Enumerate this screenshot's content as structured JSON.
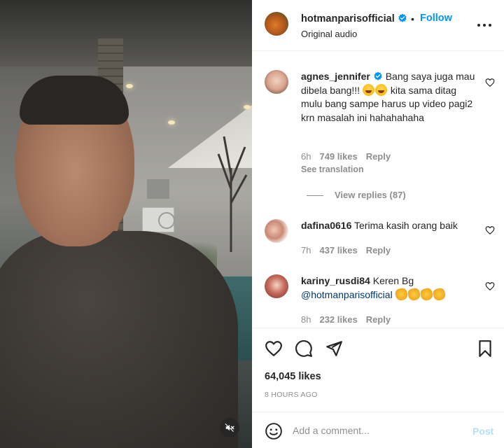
{
  "header": {
    "username": "hotmanparisofficial",
    "separator": "•",
    "follow_label": "Follow",
    "subtitle": "Original audio"
  },
  "comments": [
    {
      "username": "agnes_jennifer",
      "verified": true,
      "text_before": "Bang saya juga mau dibela bang!!! ",
      "text_after": " kita sama ditag mulu bang sampe harus up video pagi2 krn masalah ini hahahahaha",
      "time": "6h",
      "likes": "749 likes",
      "reply_label": "Reply",
      "see_translation": "See translation",
      "view_replies": "View replies (87)"
    },
    {
      "username": "dafina0616",
      "text": "Terima kasih orang baik",
      "time": "7h",
      "likes": "437 likes",
      "reply_label": "Reply"
    },
    {
      "username": "kariny_rusdi84",
      "text": "Keren Bg",
      "mention": "@hotmanparisofficial",
      "time": "8h",
      "likes": "232 likes",
      "reply_label": "Reply"
    }
  ],
  "post": {
    "likes": "64,045 likes",
    "time_ago": "8 HOURS AGO"
  },
  "composer": {
    "placeholder": "Add a comment...",
    "post_label": "Post"
  },
  "colors": {
    "accent": "#0095f6",
    "text": "#262626",
    "muted": "#8e8e8e",
    "post_disabled": "#b2dffc"
  }
}
